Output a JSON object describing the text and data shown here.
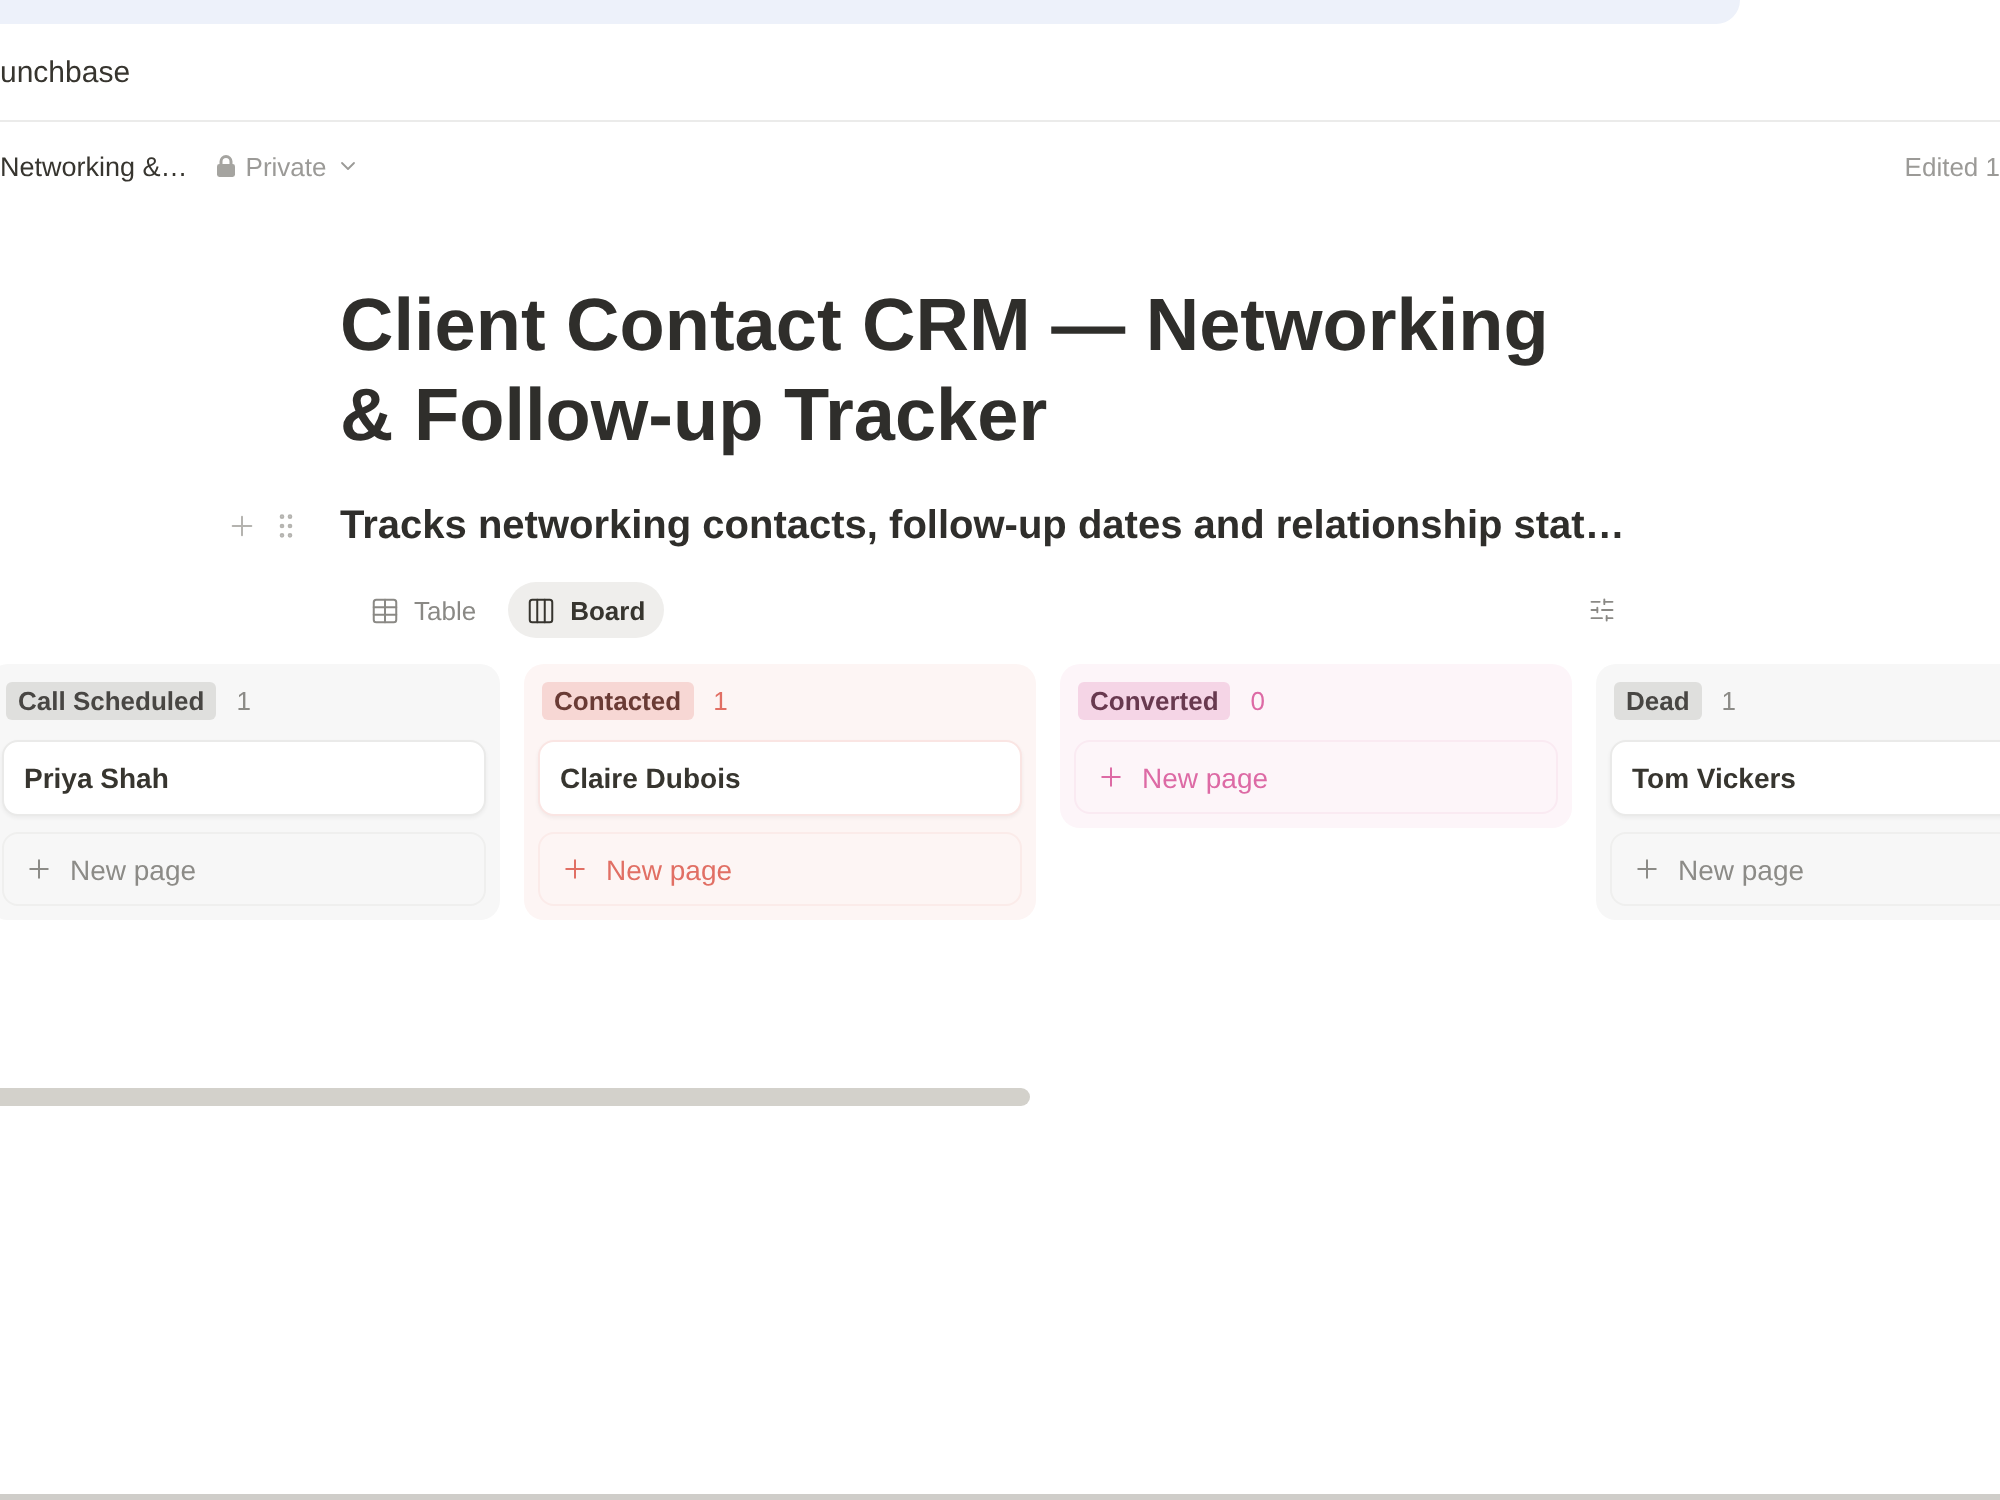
{
  "workspace": {
    "name": "unchbase"
  },
  "topbar": {
    "breadcrumb": "Networking &…",
    "privacy": "Private",
    "edited": "Edited 1"
  },
  "page": {
    "title": "Client Contact CRM — Networking & Follow-up Tracker",
    "description": "Tracks networking contacts, follow-up dates and relationship stat…"
  },
  "views": [
    {
      "label": "Table",
      "kind": "table",
      "selected": false
    },
    {
      "label": "Board",
      "kind": "board",
      "selected": true
    }
  ],
  "board": {
    "columns": [
      {
        "status": "Call Scheduled",
        "count": "1",
        "color": "#8c8b87",
        "cards": [
          {
            "title": "Priya Shah"
          }
        ],
        "add_label": "New page"
      },
      {
        "status": "Contacted",
        "count": "1",
        "color": "#e16f64",
        "cards": [
          {
            "title": "Claire Dubois"
          }
        ],
        "add_label": "New page"
      },
      {
        "status": "Converted",
        "count": "0",
        "color": "#dd6aa5",
        "add_label": "New page"
      },
      {
        "status": "Dead",
        "count": "1",
        "color": "#8c8b87",
        "cards": [
          {
            "title": "Tom Vickers"
          }
        ],
        "add_label": "New page"
      }
    ]
  }
}
